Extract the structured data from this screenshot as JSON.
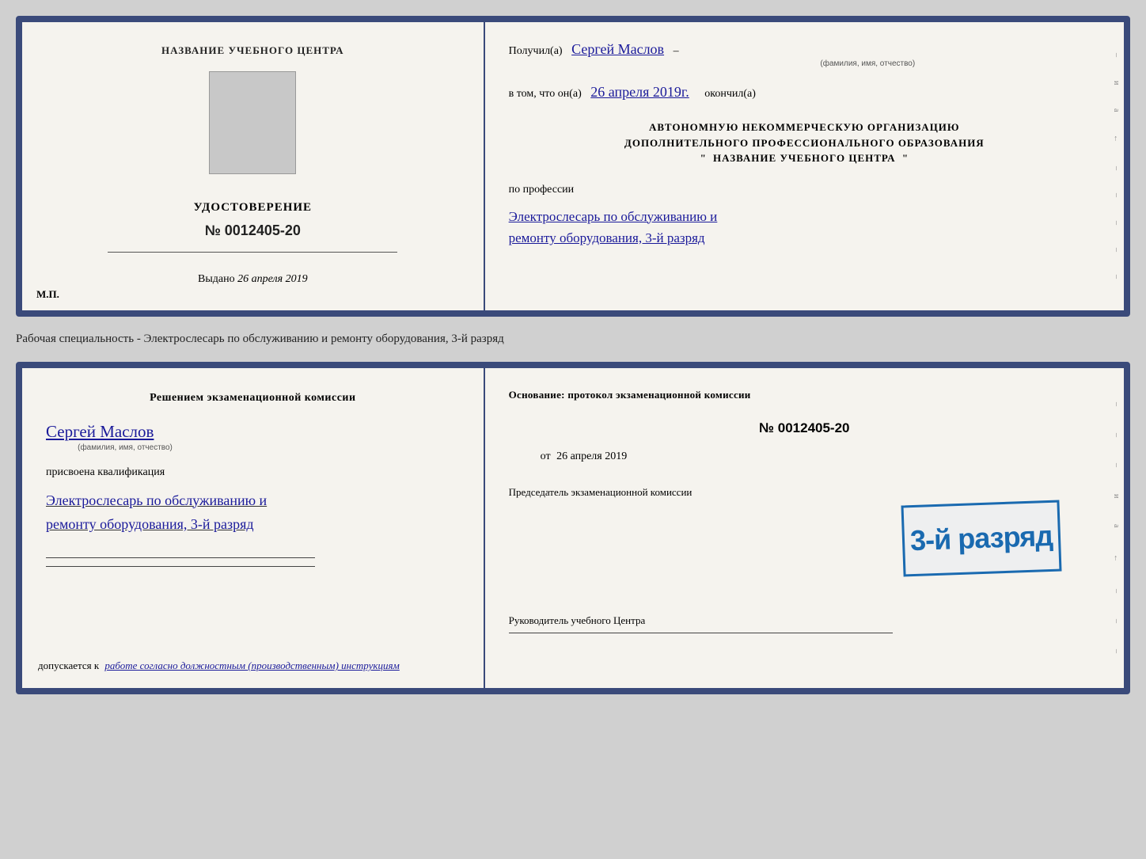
{
  "card1": {
    "left": {
      "title": "НАЗВАНИЕ УЧЕБНОГО ЦЕНТРА",
      "udost_label": "УДОСТОВЕРЕНИЕ",
      "udost_number": "№ 0012405-20",
      "vydano_prefix": "Выдано",
      "vydano_date": "26 апреля 2019",
      "mp": "М.П."
    },
    "right": {
      "poluchil_prefix": "Получил(а)",
      "poluchil_name": "Сергей Маслов",
      "fio_caption": "(фамилия, имя, отчество)",
      "vtom_prefix": "в том, что он(а)",
      "vtom_date": "26 апреля 2019г.",
      "vtom_suffix": "окончил(а)",
      "org_line1": "АВТОНОМНУЮ НЕКОММЕРЧЕСКУЮ ОРГАНИЗАЦИЮ",
      "org_line2": "ДОПОЛНИТЕЛЬНОГО ПРОФЕССИОНАЛЬНОГО ОБРАЗОВАНИЯ",
      "org_quote_open": "\"",
      "org_name": "НАЗВАНИЕ УЧЕБНОГО ЦЕНТРА",
      "org_quote_close": "\"",
      "po_professii": "по профессии",
      "profession_line1": "Электрослесарь по обслуживанию и",
      "profession_line2": "ремонту оборудования, 3-й разряд"
    }
  },
  "between_label": "Рабочая специальность - Электрослесарь по обслуживанию и ремонту оборудования, 3-й разряд",
  "card2": {
    "left": {
      "resheniyem": "Решением экзаменационной комиссии",
      "name": "Сергей Маслов",
      "fio_caption": "(фамилия, имя, отчество)",
      "prisvoena": "присвоена квалификация",
      "qual_line1": "Электрослесарь по обслуживанию и",
      "qual_line2": "ремонту оборудования, 3-й разряд",
      "dopusk_prefix": "допускается к",
      "dopusk_text": "работе согласно должностным (производственным) инструкциям"
    },
    "right": {
      "osnov_prefix": "Основание: протокол экзаменационной комиссии",
      "proto_number": "№  0012405-20",
      "ot_label": "от",
      "ot_date": "26 апреля 2019",
      "predsedatel_title": "Председатель экзаменационной комиссии",
      "stamp_text": "3-й разряд",
      "ruk_label": "Руководитель учебного Центра"
    }
  }
}
